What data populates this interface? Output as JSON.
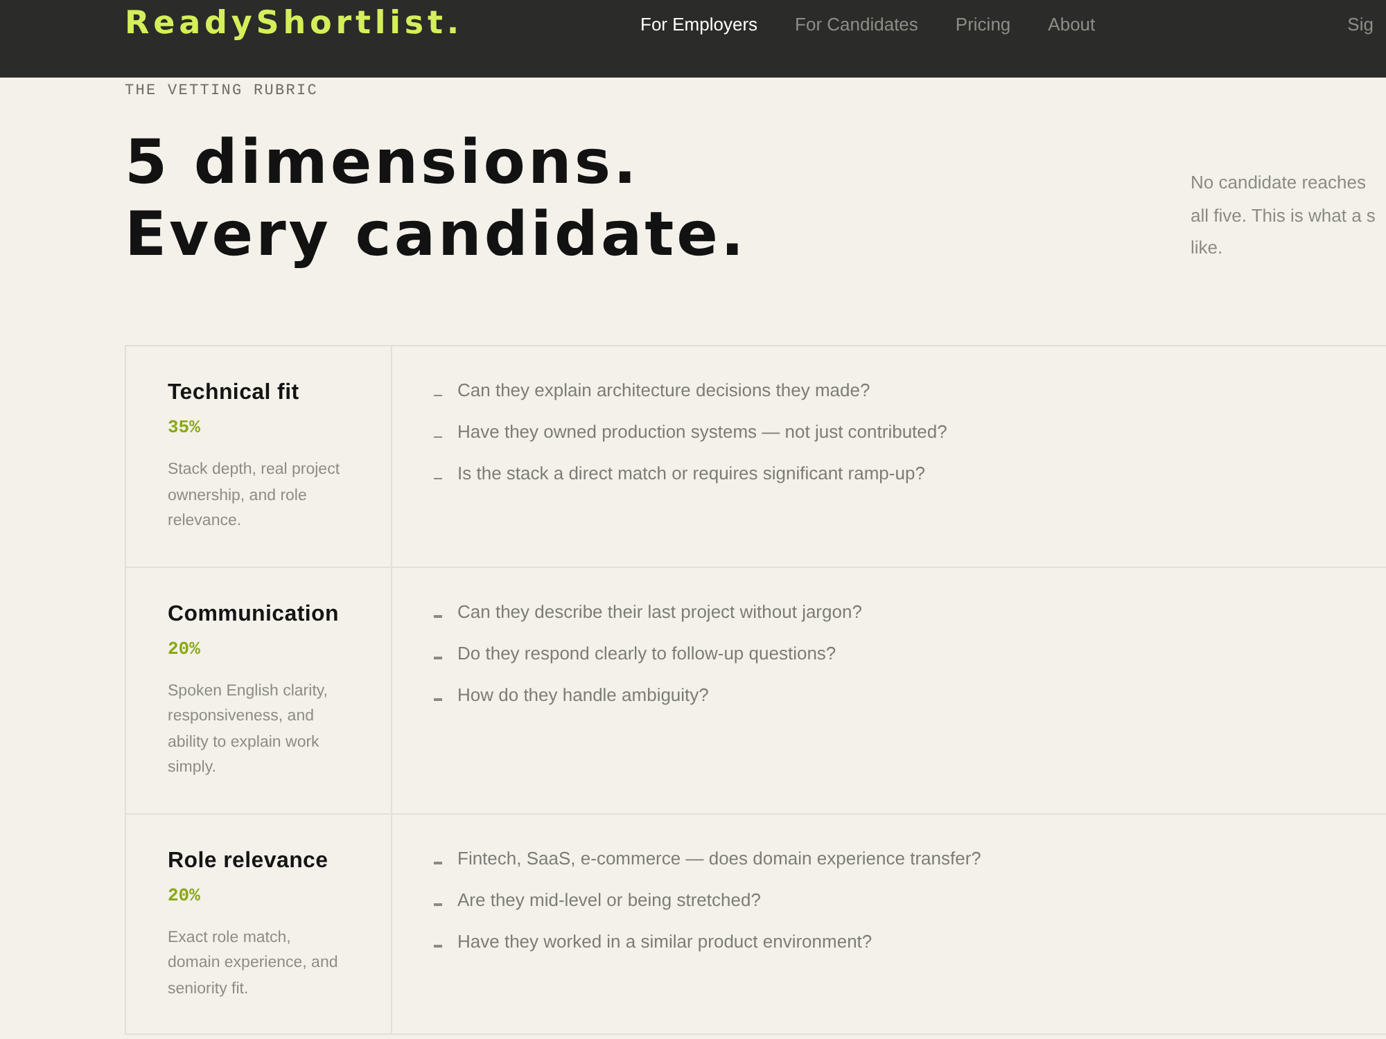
{
  "nav": {
    "logo": "ReadyShortlist.",
    "links": [
      {
        "label": "For Employers",
        "selected": true
      },
      {
        "label": "For Candidates",
        "selected": false
      },
      {
        "label": "Pricing",
        "selected": false
      },
      {
        "label": "About",
        "selected": false
      }
    ],
    "sign_in": "Sig"
  },
  "hero": {
    "eyebrow": "THE VETTING RUBRIC",
    "heading_lines": [
      "5 dimensions.",
      "Every candidate."
    ],
    "intro_lines": [
      "No candidate reaches",
      "all five. This is what a s",
      "like."
    ]
  },
  "rubric": [
    {
      "title": "Technical fit",
      "weight": "35%",
      "description": "Stack depth, real project ownership, and role relevance.",
      "questions": [
        "Can they explain architecture decisions they made?",
        "Have they owned production systems — not just contributed?",
        "Is the stack a direct match or requires significant ramp-up?"
      ]
    },
    {
      "title": "Communication",
      "weight": "20%",
      "description": "Spoken English clarity, responsiveness, and ability to explain work simply.",
      "questions": [
        "Can they describe their last project without jargon?",
        "Do they respond clearly to follow-up questions?",
        "How do they handle ambiguity?"
      ]
    },
    {
      "title": "Role relevance",
      "weight": "20%",
      "description": "Exact role match, domain experience, and seniority fit.",
      "questions": [
        "Fintech, SaaS, e-commerce — does domain experience transfer?",
        "Are they mid-level or being stretched?",
        "Have they worked in a similar product environment?"
      ]
    }
  ]
}
